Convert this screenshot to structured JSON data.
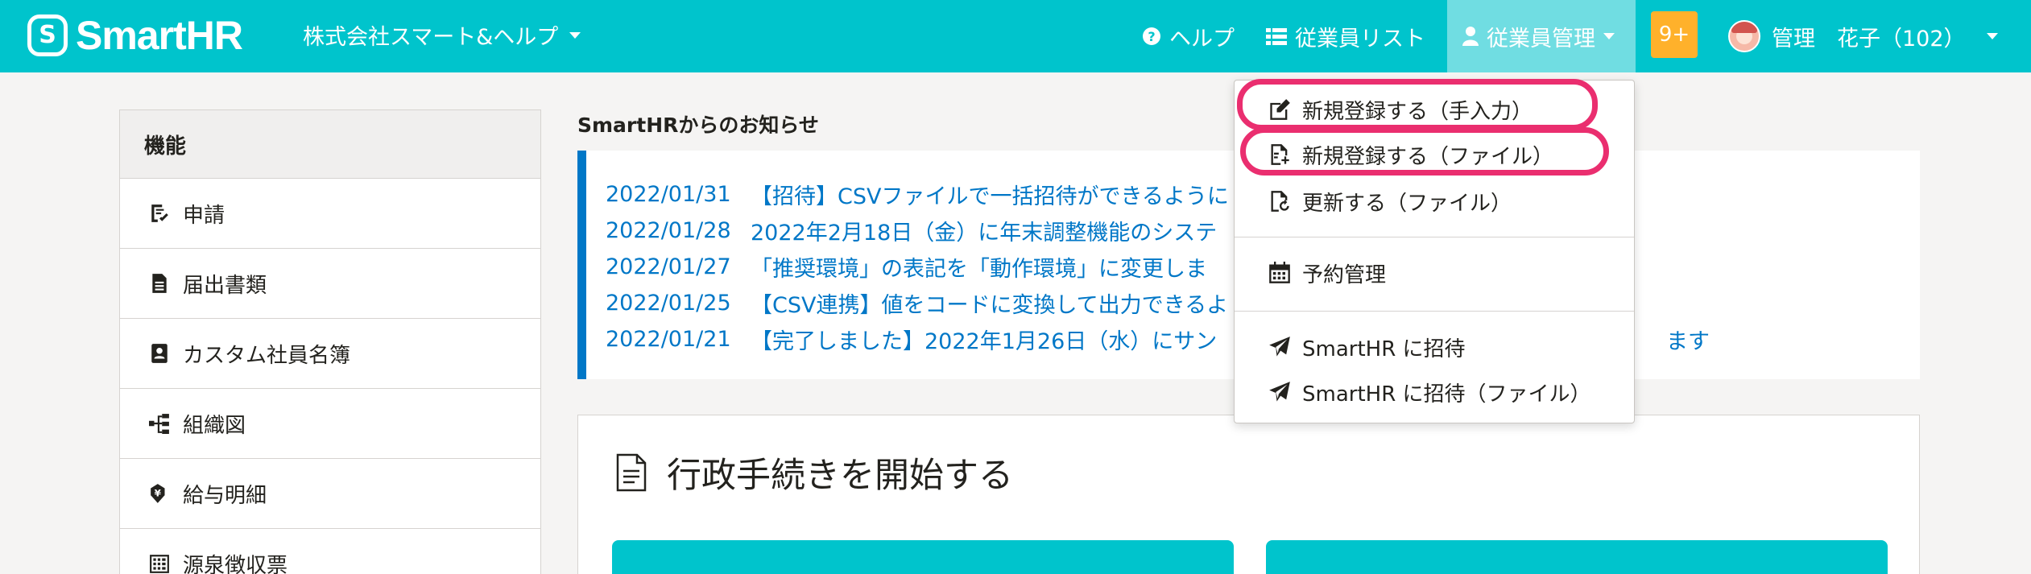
{
  "header": {
    "logo_mark": "S",
    "logo_text": "SmartHR",
    "company": "株式会社スマート&ヘルプ",
    "nav": {
      "help": "ヘルプ",
      "employee_list": "従業員リスト",
      "employee_mgmt": "従業員管理"
    },
    "notification_badge": "9+",
    "user_name": "管理　花子（102）"
  },
  "sidebar": {
    "heading": "機能",
    "items": [
      {
        "label": "申請",
        "icon": "request-check-icon"
      },
      {
        "label": "届出書類",
        "icon": "document-icon"
      },
      {
        "label": "カスタム社員名簿",
        "icon": "id-book-icon"
      },
      {
        "label": "組織図",
        "icon": "org-chart-icon"
      },
      {
        "label": "給与明細",
        "icon": "payslip-yen-icon"
      },
      {
        "label": "源泉徴収票",
        "icon": "calculator-icon"
      }
    ]
  },
  "news": {
    "title": "SmartHRからのお知らせ",
    "items": [
      {
        "date": "2022/01/31",
        "text": "【招待】CSVファイルで一括招待ができるように"
      },
      {
        "date": "2022/01/28",
        "text": "2022年2月18日（金）に年末調整機能のシステ"
      },
      {
        "date": "2022/01/27",
        "text": "「推奨環境」の表記を「動作環境」に変更しま"
      },
      {
        "date": "2022/01/25",
        "text": "【CSV連携】値をコードに変換して出力できるよ"
      },
      {
        "date": "2022/01/21",
        "text": "【完了しました】2022年1月26日（水）にサン",
        "tail": "ます"
      }
    ]
  },
  "procedures": {
    "title": "行政手続きを開始する"
  },
  "dropdown": {
    "items": [
      {
        "label": "新規登録する（手入力）",
        "icon": "edit-square-icon",
        "highlighted": true
      },
      {
        "label": "新規登録する（ファイル）",
        "icon": "file-add-icon",
        "highlighted": true
      },
      {
        "label": "更新する（ファイル）",
        "icon": "file-refresh-icon",
        "highlighted": false
      },
      {
        "label": "予約管理",
        "icon": "calendar-icon",
        "highlighted": false
      },
      {
        "label": "SmartHR に招待",
        "icon": "paper-plane-icon",
        "highlighted": false
      },
      {
        "label": "SmartHR に招待（ファイル）",
        "icon": "paper-plane-icon",
        "highlighted": false
      }
    ]
  },
  "colors": {
    "brand": "#00c4cc",
    "link": "#0077c7",
    "highlight": "#ea2e6f",
    "badge": "#ffb12b"
  }
}
